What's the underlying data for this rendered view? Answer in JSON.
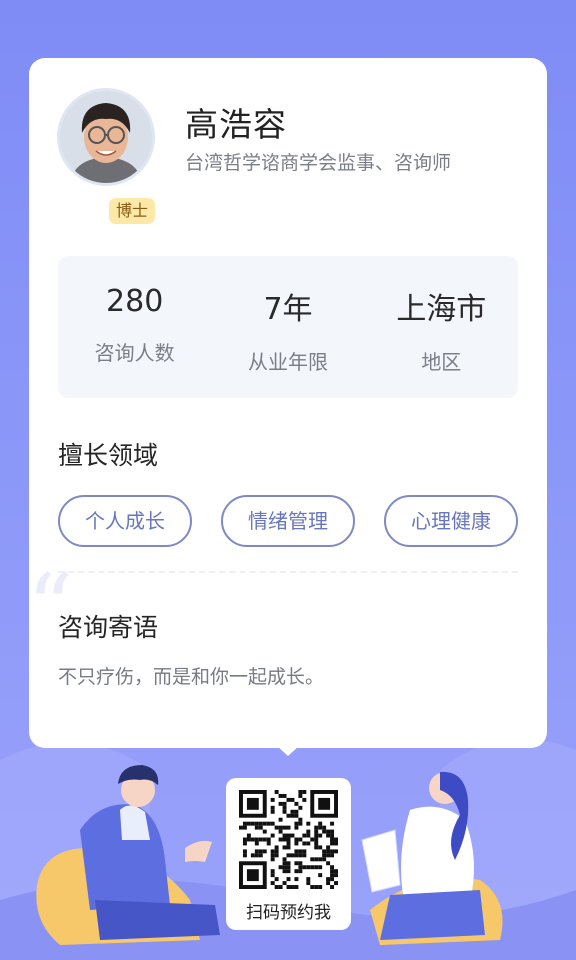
{
  "profile": {
    "name": "高浩容",
    "title": "台湾哲学谘商学会监事、咨询师",
    "degree_badge": "博士"
  },
  "stats": [
    {
      "value": "280",
      "label": "咨询人数"
    },
    {
      "value": "7年",
      "label": "从业年限"
    },
    {
      "value": "上海市",
      "label": "地区"
    }
  ],
  "expertise": {
    "title": "擅长领域",
    "tags": [
      "个人成长",
      "情绪管理",
      "心理健康"
    ]
  },
  "motto": {
    "title": "咨询寄语",
    "text": "不只疗伤，而是和你一起成长。"
  },
  "qr": {
    "label": "扫码预约我"
  },
  "colors": {
    "background": "#8b97f8",
    "tag_border": "#7d8ac4",
    "badge": "#fde9a7"
  }
}
